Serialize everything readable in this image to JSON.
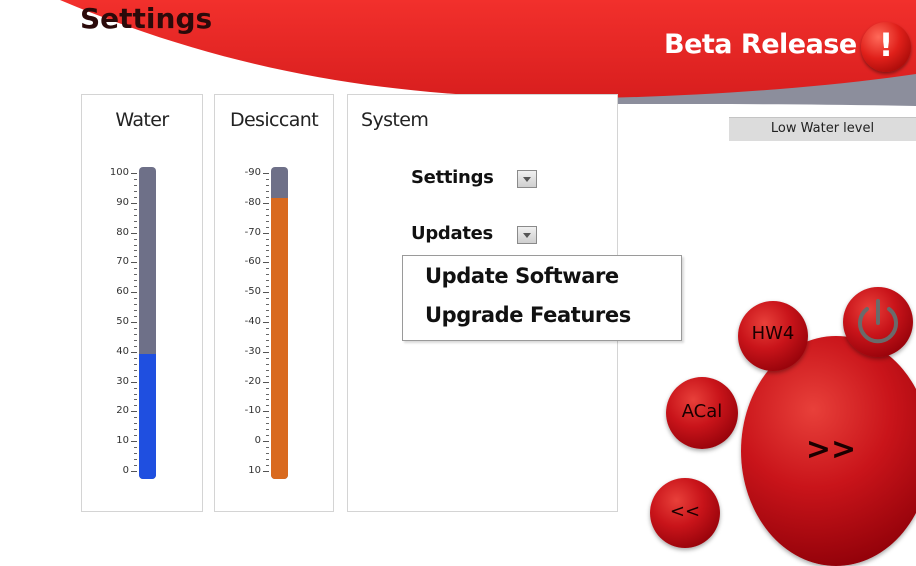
{
  "header": {
    "title": "Settings",
    "release_label": "Beta Release",
    "alert_symbol": "!"
  },
  "panels": {
    "water": {
      "title": "Water",
      "level": 40,
      "scale_min": 0,
      "scale_max": 100,
      "ticks": [
        "100",
        "90",
        "80",
        "70",
        "60",
        "50",
        "40",
        "30",
        "20",
        "10",
        "0"
      ],
      "fill_color": "#1f4fe0"
    },
    "desiccant": {
      "title": "Desiccant",
      "level": -80,
      "scale_min": 10,
      "scale_max": -90,
      "ticks": [
        "-90",
        "-80",
        "-70",
        "-60",
        "-50",
        "-40",
        "-30",
        "-20",
        "-10",
        "0",
        "10"
      ],
      "fill_color": "#d96a1f"
    },
    "system": {
      "title": "System",
      "settings_label": "Settings",
      "updates_label": "Updates",
      "menu_items": [
        "Update Software",
        "Upgrade Features"
      ]
    }
  },
  "status": {
    "message": "Low Water level"
  },
  "controls": {
    "hw_label": "HW4",
    "acal_label": "ACal",
    "next_label": ">>",
    "prev_label": "<<",
    "power_icon": "power-icon"
  },
  "colors": {
    "header_red": "#e02020",
    "track_gray": "#6e7088",
    "button_red": "#c9141a"
  }
}
